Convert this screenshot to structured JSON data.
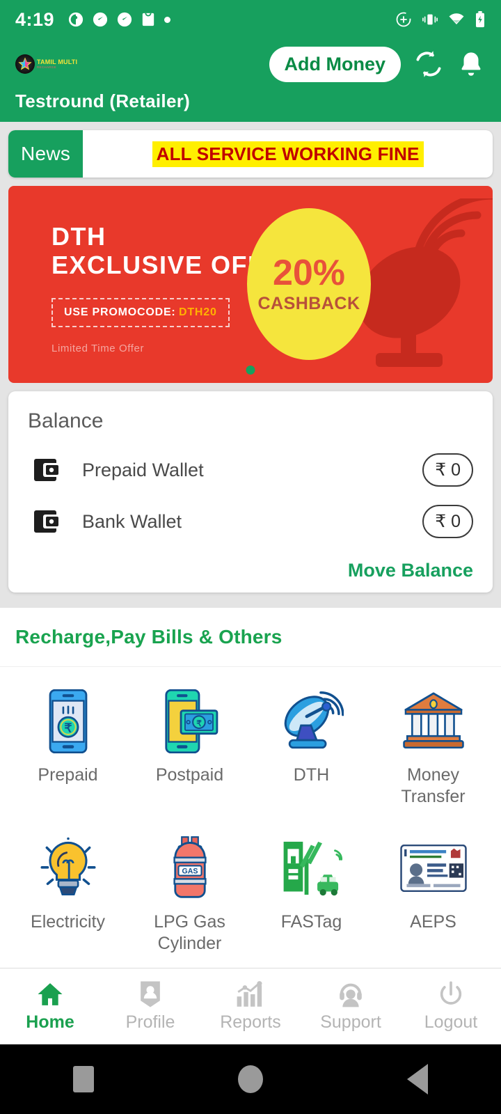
{
  "status_bar": {
    "time": "4:19",
    "left_icons": [
      "notification-icon",
      "speedometer-icon",
      "speedometer-icon",
      "bag-icon",
      "dot-icon"
    ],
    "right_icons": [
      "data-saver-icon",
      "vibrate-icon",
      "wifi-icon",
      "battery-charging-icon"
    ]
  },
  "header": {
    "logo_name": "TAMIL MULTI",
    "logo_sub": "RECHARGE",
    "add_money_label": "Add Money",
    "refresh_icon": "refresh-icon",
    "notification_icon": "bell-icon",
    "username": "Testround (Retailer)",
    "bg_color": "#17a05e"
  },
  "news": {
    "label": "News",
    "text": "ALL SERVICE WORKING FINE",
    "text_color": "#c00000",
    "highlight_color": "#ffef00"
  },
  "banner": {
    "title_line1": "DTH",
    "title_line2": "EXCLUSIVE OFFER",
    "promo_prefix": "USE PROMOCODE:",
    "promo_code": "DTH20",
    "limited": "Limited Time Offer",
    "cashback_pct": "20%",
    "cashback_label": "CASHBACK",
    "bg_color": "#e8392b",
    "circle_color": "#f5e53d",
    "dot_count": 1,
    "active_dot": 0
  },
  "balance": {
    "title": "Balance",
    "rows": [
      {
        "icon": "wallet-icon",
        "label": "Prepaid Wallet",
        "amount": "₹ 0"
      },
      {
        "icon": "wallet-icon",
        "label": "Bank Wallet",
        "amount": "₹ 0"
      }
    ],
    "move_label": "Move Balance",
    "move_color": "#17a05e"
  },
  "services": {
    "heading": "Recharge,Pay Bills & Others",
    "heading_color": "#19a34f",
    "items": [
      {
        "label": "Prepaid",
        "icon": "mobile-rupee-icon"
      },
      {
        "label": "Postpaid",
        "icon": "mobile-bill-icon"
      },
      {
        "label": "DTH",
        "icon": "satellite-dish-icon"
      },
      {
        "label": "Money\nTransfer",
        "icon": "bank-icon"
      },
      {
        "label": "Electricity",
        "icon": "lightbulb-icon"
      },
      {
        "label": "LPG Gas\nCylinder",
        "icon": "gas-cylinder-icon"
      },
      {
        "label": "FASTag",
        "icon": "toll-booth-icon"
      },
      {
        "label": "AEPS",
        "icon": "id-card-icon"
      }
    ]
  },
  "bottom_nav": {
    "items": [
      {
        "label": "Home",
        "icon": "home-icon",
        "active": true
      },
      {
        "label": "Profile",
        "icon": "profile-icon",
        "active": false
      },
      {
        "label": "Reports",
        "icon": "chart-icon",
        "active": false
      },
      {
        "label": "Support",
        "icon": "headset-icon",
        "active": false
      },
      {
        "label": "Logout",
        "icon": "power-icon",
        "active": false
      }
    ],
    "active_color": "#1aa04f",
    "inactive_color": "#b4b4b4"
  },
  "system_nav": {
    "recents_icon": "square-icon",
    "home_icon": "circle-icon",
    "back_icon": "triangle-back-icon"
  }
}
